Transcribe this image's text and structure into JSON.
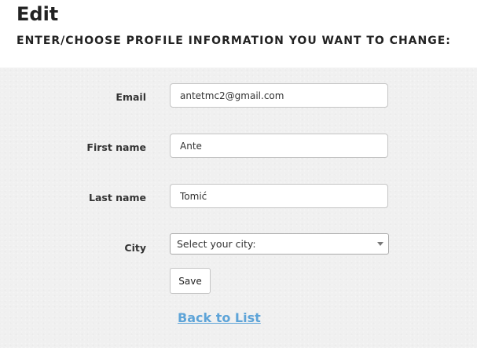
{
  "header": {
    "title": "Edit",
    "subtitle": "ENTER/CHOOSE PROFILE INFORMATION YOU WANT TO CHANGE:"
  },
  "form": {
    "email": {
      "label": "Email",
      "value": "antetmc2@gmail.com"
    },
    "first_name": {
      "label": "First name",
      "value": "Ante"
    },
    "last_name": {
      "label": "Last name",
      "value": "Tomić"
    },
    "city": {
      "label": "City",
      "selected": "Select your city:"
    },
    "save_label": "Save"
  },
  "links": {
    "back_to_list": "Back to List"
  },
  "colors": {
    "link": "#5ea4d8",
    "background": "#f0f0f0"
  }
}
